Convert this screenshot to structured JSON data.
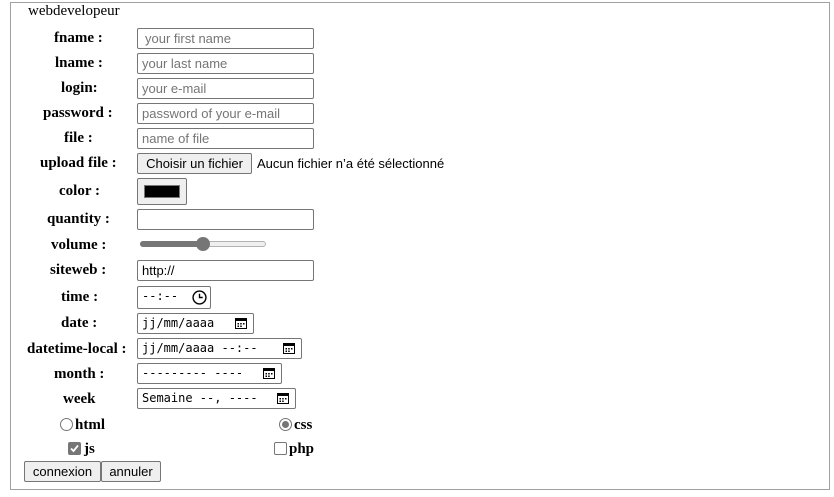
{
  "legend": "webdevelopeur",
  "fields": {
    "fname": {
      "label": "fname :",
      "placeholder": "your first name"
    },
    "lname": {
      "label": "lname :",
      "placeholder": "your last name"
    },
    "login": {
      "label": "login:",
      "placeholder": "your e-mail"
    },
    "password": {
      "label": "password :",
      "placeholder": "password of your e-mail"
    },
    "file": {
      "label": "file :",
      "placeholder": "name of file"
    },
    "upload": {
      "label": "upload file :",
      "button": "Choisir un fichier",
      "status": "Aucun fichier n’a été sélectionné"
    },
    "color": {
      "label": "color :",
      "value": "#000000"
    },
    "quantity": {
      "label": "quantity :",
      "value": ""
    },
    "volume": {
      "label": "volume :",
      "value": 0.5
    },
    "siteweb": {
      "label": "siteweb :",
      "value": "http://"
    },
    "time": {
      "label": "time :",
      "value": "--:--"
    },
    "date": {
      "label": "date :",
      "value": "jj/mm/aaaa"
    },
    "datetime": {
      "label": "datetime-local :",
      "value": "jj/mm/aaaa --:--"
    },
    "month": {
      "label": "month :",
      "value": "--------- ----"
    },
    "week": {
      "label": "week",
      "value": "Semaine --, ----"
    }
  },
  "options": {
    "html": {
      "label": "html",
      "checked": false
    },
    "css": {
      "label": "css",
      "checked": true
    },
    "js": {
      "label": "js",
      "checked": true
    },
    "php": {
      "label": "php",
      "checked": false
    }
  },
  "buttons": {
    "submit": "connexion",
    "reset": "annuler"
  }
}
